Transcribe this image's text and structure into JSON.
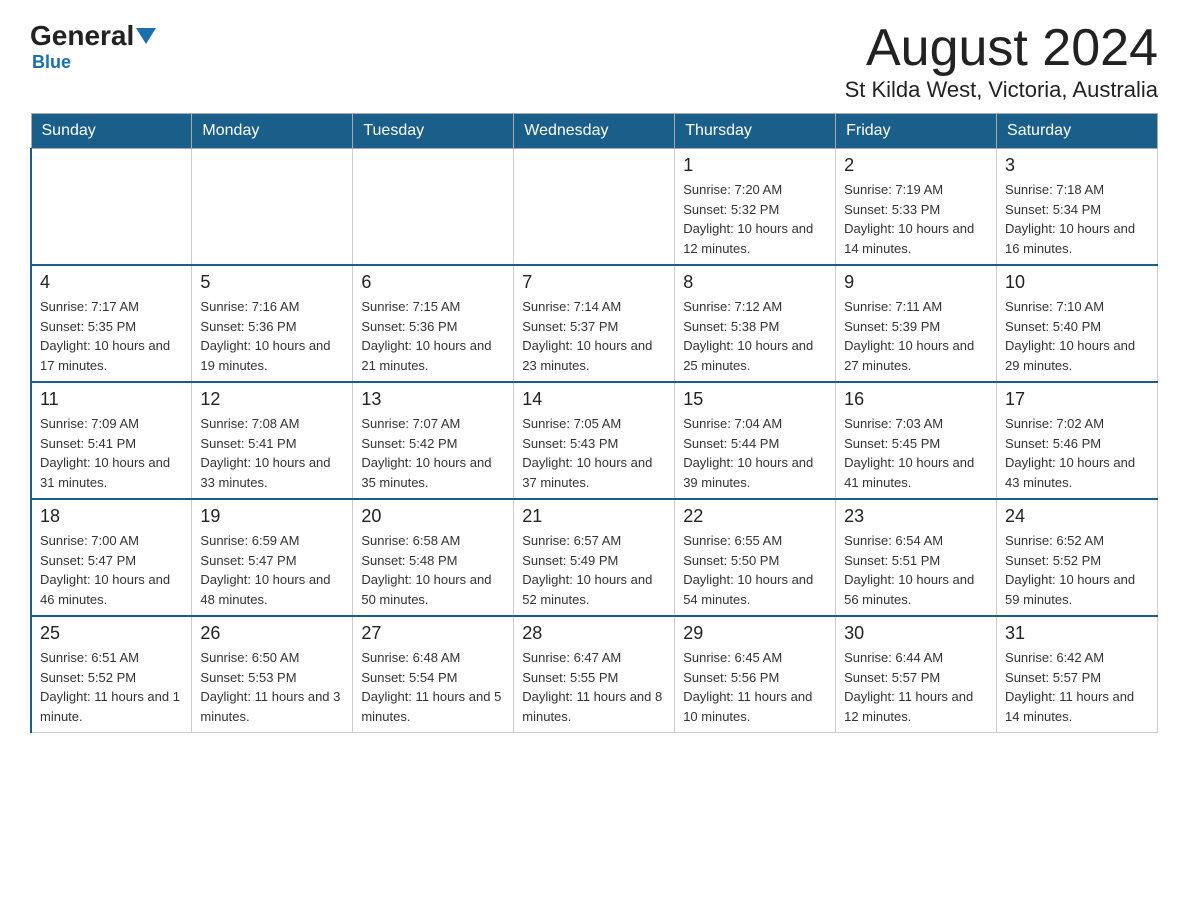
{
  "logo": {
    "general": "General",
    "triangle": "",
    "blue": "Blue"
  },
  "header": {
    "title": "August 2024",
    "subtitle": "St Kilda West, Victoria, Australia"
  },
  "days_of_week": [
    "Sunday",
    "Monday",
    "Tuesday",
    "Wednesday",
    "Thursday",
    "Friday",
    "Saturday"
  ],
  "weeks": [
    [
      {
        "day": "",
        "info": ""
      },
      {
        "day": "",
        "info": ""
      },
      {
        "day": "",
        "info": ""
      },
      {
        "day": "",
        "info": ""
      },
      {
        "day": "1",
        "info": "Sunrise: 7:20 AM\nSunset: 5:32 PM\nDaylight: 10 hours and 12 minutes."
      },
      {
        "day": "2",
        "info": "Sunrise: 7:19 AM\nSunset: 5:33 PM\nDaylight: 10 hours and 14 minutes."
      },
      {
        "day": "3",
        "info": "Sunrise: 7:18 AM\nSunset: 5:34 PM\nDaylight: 10 hours and 16 minutes."
      }
    ],
    [
      {
        "day": "4",
        "info": "Sunrise: 7:17 AM\nSunset: 5:35 PM\nDaylight: 10 hours and 17 minutes."
      },
      {
        "day": "5",
        "info": "Sunrise: 7:16 AM\nSunset: 5:36 PM\nDaylight: 10 hours and 19 minutes."
      },
      {
        "day": "6",
        "info": "Sunrise: 7:15 AM\nSunset: 5:36 PM\nDaylight: 10 hours and 21 minutes."
      },
      {
        "day": "7",
        "info": "Sunrise: 7:14 AM\nSunset: 5:37 PM\nDaylight: 10 hours and 23 minutes."
      },
      {
        "day": "8",
        "info": "Sunrise: 7:12 AM\nSunset: 5:38 PM\nDaylight: 10 hours and 25 minutes."
      },
      {
        "day": "9",
        "info": "Sunrise: 7:11 AM\nSunset: 5:39 PM\nDaylight: 10 hours and 27 minutes."
      },
      {
        "day": "10",
        "info": "Sunrise: 7:10 AM\nSunset: 5:40 PM\nDaylight: 10 hours and 29 minutes."
      }
    ],
    [
      {
        "day": "11",
        "info": "Sunrise: 7:09 AM\nSunset: 5:41 PM\nDaylight: 10 hours and 31 minutes."
      },
      {
        "day": "12",
        "info": "Sunrise: 7:08 AM\nSunset: 5:41 PM\nDaylight: 10 hours and 33 minutes."
      },
      {
        "day": "13",
        "info": "Sunrise: 7:07 AM\nSunset: 5:42 PM\nDaylight: 10 hours and 35 minutes."
      },
      {
        "day": "14",
        "info": "Sunrise: 7:05 AM\nSunset: 5:43 PM\nDaylight: 10 hours and 37 minutes."
      },
      {
        "day": "15",
        "info": "Sunrise: 7:04 AM\nSunset: 5:44 PM\nDaylight: 10 hours and 39 minutes."
      },
      {
        "day": "16",
        "info": "Sunrise: 7:03 AM\nSunset: 5:45 PM\nDaylight: 10 hours and 41 minutes."
      },
      {
        "day": "17",
        "info": "Sunrise: 7:02 AM\nSunset: 5:46 PM\nDaylight: 10 hours and 43 minutes."
      }
    ],
    [
      {
        "day": "18",
        "info": "Sunrise: 7:00 AM\nSunset: 5:47 PM\nDaylight: 10 hours and 46 minutes."
      },
      {
        "day": "19",
        "info": "Sunrise: 6:59 AM\nSunset: 5:47 PM\nDaylight: 10 hours and 48 minutes."
      },
      {
        "day": "20",
        "info": "Sunrise: 6:58 AM\nSunset: 5:48 PM\nDaylight: 10 hours and 50 minutes."
      },
      {
        "day": "21",
        "info": "Sunrise: 6:57 AM\nSunset: 5:49 PM\nDaylight: 10 hours and 52 minutes."
      },
      {
        "day": "22",
        "info": "Sunrise: 6:55 AM\nSunset: 5:50 PM\nDaylight: 10 hours and 54 minutes."
      },
      {
        "day": "23",
        "info": "Sunrise: 6:54 AM\nSunset: 5:51 PM\nDaylight: 10 hours and 56 minutes."
      },
      {
        "day": "24",
        "info": "Sunrise: 6:52 AM\nSunset: 5:52 PM\nDaylight: 10 hours and 59 minutes."
      }
    ],
    [
      {
        "day": "25",
        "info": "Sunrise: 6:51 AM\nSunset: 5:52 PM\nDaylight: 11 hours and 1 minute."
      },
      {
        "day": "26",
        "info": "Sunrise: 6:50 AM\nSunset: 5:53 PM\nDaylight: 11 hours and 3 minutes."
      },
      {
        "day": "27",
        "info": "Sunrise: 6:48 AM\nSunset: 5:54 PM\nDaylight: 11 hours and 5 minutes."
      },
      {
        "day": "28",
        "info": "Sunrise: 6:47 AM\nSunset: 5:55 PM\nDaylight: 11 hours and 8 minutes."
      },
      {
        "day": "29",
        "info": "Sunrise: 6:45 AM\nSunset: 5:56 PM\nDaylight: 11 hours and 10 minutes."
      },
      {
        "day": "30",
        "info": "Sunrise: 6:44 AM\nSunset: 5:57 PM\nDaylight: 11 hours and 12 minutes."
      },
      {
        "day": "31",
        "info": "Sunrise: 6:42 AM\nSunset: 5:57 PM\nDaylight: 11 hours and 14 minutes."
      }
    ]
  ]
}
